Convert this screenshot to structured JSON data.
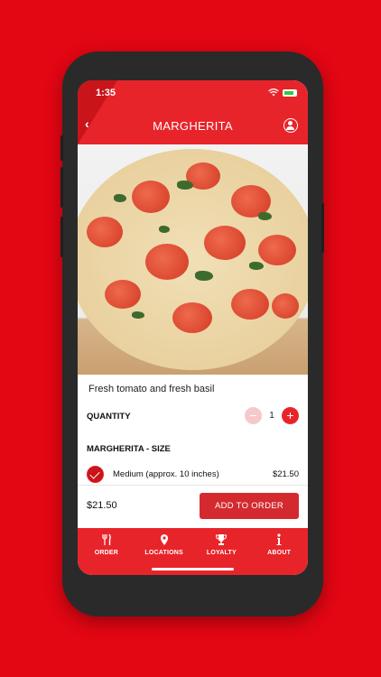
{
  "status": {
    "time": "1:35"
  },
  "header": {
    "title": "MARGHERITA"
  },
  "product": {
    "description": "Fresh tomato and fresh basil",
    "quantity_label": "QUANTITY",
    "quantity_value": "1",
    "minus_symbol": "−",
    "plus_symbol": "+",
    "size_section_label": "MARGHERITA - SIZE",
    "size_option": {
      "label": "Medium (approx. 10 inches)",
      "price": "$21.50",
      "selected": true
    }
  },
  "footer": {
    "total": "$21.50",
    "add_button_label": "ADD TO ORDER"
  },
  "nav": {
    "items": [
      {
        "label": "ORDER",
        "icon": "utensils-icon"
      },
      {
        "label": "LOCATIONS",
        "icon": "map-pin-icon"
      },
      {
        "label": "LOYALTY",
        "icon": "trophy-icon"
      },
      {
        "label": "ABOUT",
        "icon": "info-icon"
      }
    ]
  },
  "colors": {
    "brand_red": "#e8242b",
    "dark_red": "#c9141a",
    "background": "#e30613"
  }
}
